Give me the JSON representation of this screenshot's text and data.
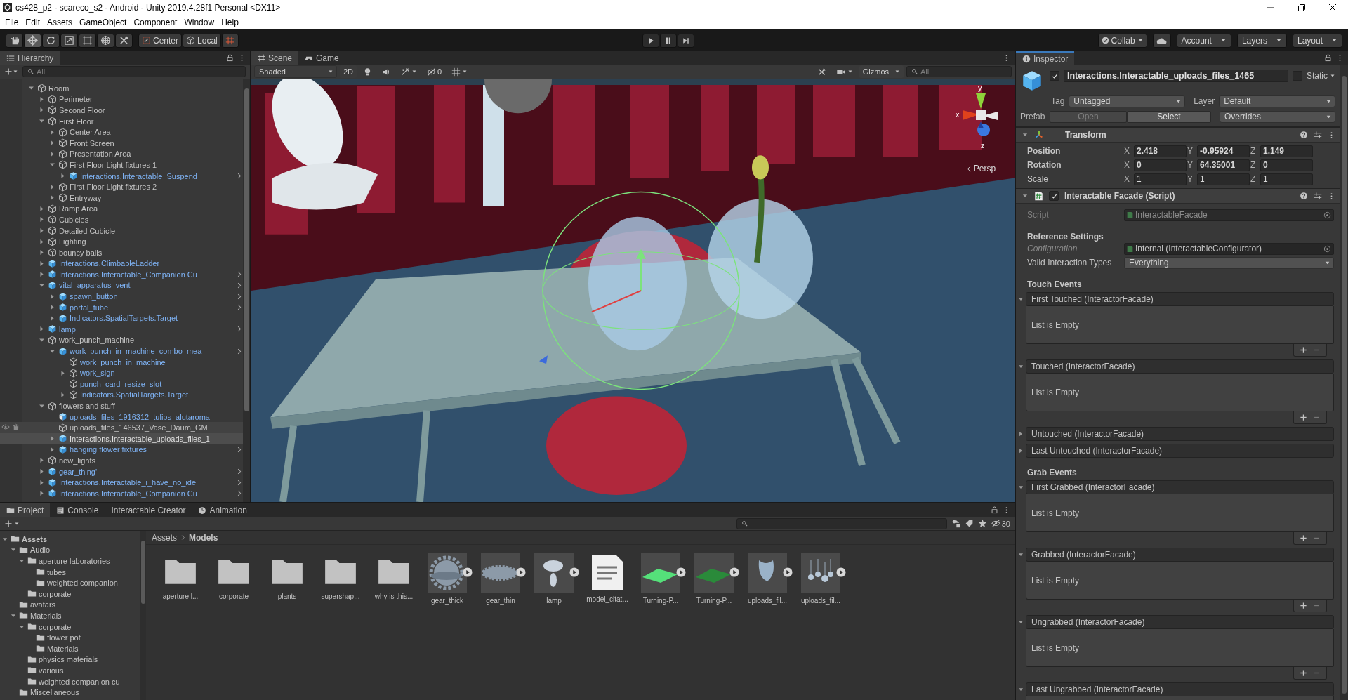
{
  "window": {
    "title": "cs428_p2 - scareco_s2 - Android - Unity 2019.4.28f1 Personal <DX11>"
  },
  "menu": [
    "File",
    "Edit",
    "Assets",
    "GameObject",
    "Component",
    "Window",
    "Help"
  ],
  "toolbar": {
    "tools": [
      {
        "kind": "hand",
        "selected": false
      },
      {
        "kind": "move",
        "selected": true
      },
      {
        "kind": "rotate",
        "selected": false
      },
      {
        "kind": "scale",
        "selected": false
      },
      {
        "kind": "rect",
        "selected": false
      },
      {
        "kind": "transform",
        "selected": false
      },
      {
        "kind": "custom",
        "selected": false
      }
    ],
    "pivot": "Center",
    "space": "Local",
    "play_controls": [
      {
        "kind": "play"
      },
      {
        "kind": "pause"
      },
      {
        "kind": "step"
      }
    ],
    "collab": "Collab",
    "account": "Account",
    "layers": "Layers",
    "layout": "Layout"
  },
  "hierarchy": {
    "title": "Hierarchy",
    "search_placeholder": "All",
    "items": [
      {
        "name": "Room",
        "kind": "gameobject",
        "expanded": true,
        "selected": false,
        "hovered": false,
        "children": [
          {
            "name": "Perimeter",
            "kind": "gameobject",
            "expanded": false,
            "selected": false,
            "hovered": false
          },
          {
            "name": "Second Floor",
            "kind": "gameobject",
            "expanded": false,
            "selected": false,
            "hovered": false
          },
          {
            "name": "First Floor",
            "kind": "gameobject",
            "expanded": true,
            "selected": false,
            "hovered": false,
            "children": [
              {
                "name": "Center Area",
                "kind": "gameobject",
                "expanded": false,
                "selected": false,
                "hovered": false
              },
              {
                "name": "Front Screen",
                "kind": "gameobject",
                "expanded": false,
                "selected": false,
                "hovered": false
              },
              {
                "name": "Presentation Area",
                "kind": "gameobject",
                "expanded": false,
                "selected": false,
                "hovered": false
              },
              {
                "name": "First Floor Light fixtures 1",
                "kind": "gameobject",
                "expanded": true,
                "selected": false,
                "hovered": false,
                "children": [
                  {
                    "name": "Interactions.Interactable_Suspend",
                    "kind": "prefab",
                    "expanded": false,
                    "selected": false,
                    "hovered": false,
                    "arrow": true
                  }
                ]
              },
              {
                "name": "First Floor Light fixtures 2",
                "kind": "gameobject",
                "expanded": false,
                "selected": false,
                "hovered": false
              },
              {
                "name": "Entryway",
                "kind": "gameobject",
                "expanded": false,
                "selected": false,
                "hovered": false
              }
            ]
          },
          {
            "name": "Ramp Area",
            "kind": "gameobject",
            "expanded": false,
            "selected": false,
            "hovered": false
          },
          {
            "name": "Cubicles",
            "kind": "gameobject",
            "expanded": false,
            "selected": false,
            "hovered": false
          },
          {
            "name": "Detailed Cubicle",
            "kind": "gameobject",
            "expanded": false,
            "selected": false,
            "hovered": false
          },
          {
            "name": "Lighting",
            "kind": "gameobject",
            "expanded": false,
            "selected": false,
            "hovered": false
          },
          {
            "name": "bouncy balls",
            "kind": "gameobject",
            "expanded": false,
            "selected": false,
            "hovered": false
          },
          {
            "name": "Interactions.ClimbableLadder",
            "kind": "prefab",
            "expanded": false,
            "selected": false,
            "hovered": false
          },
          {
            "name": "Interactions.Interactable_Companion Cu",
            "kind": "prefab",
            "expanded": false,
            "selected": false,
            "hovered": false,
            "arrow": true
          },
          {
            "name": "vital_apparatus_vent",
            "kind": "prefab",
            "expanded": true,
            "selected": false,
            "hovered": false,
            "arrow": true,
            "children": [
              {
                "name": "spawn_button",
                "kind": "prefab",
                "expanded": false,
                "selected": false,
                "hovered": false,
                "arrow": true
              },
              {
                "name": "portal_tube",
                "kind": "prefab",
                "expanded": false,
                "selected": false,
                "hovered": false,
                "arrow": true
              },
              {
                "name": "Indicators.SpatialTargets.Target",
                "kind": "prefab",
                "expanded": false,
                "selected": false,
                "hovered": false
              }
            ]
          },
          {
            "name": "lamp",
            "kind": "prefab",
            "expanded": false,
            "selected": false,
            "hovered": false,
            "arrow": true
          },
          {
            "name": "work_punch_machine",
            "kind": "gameobject",
            "expanded": true,
            "selected": false,
            "hovered": false,
            "children": [
              {
                "name": "work_punch_in_machine_combo_mea",
                "kind": "prefab",
                "expanded": true,
                "selected": false,
                "hovered": false,
                "arrow": true,
                "children": [
                  {
                    "name": "work_punch_in_machine",
                    "kind": "prefab_child",
                    "selected": false,
                    "hovered": false
                  },
                  {
                    "name": "work_sign",
                    "kind": "prefab_child",
                    "expanded": false,
                    "selected": false,
                    "hovered": false
                  },
                  {
                    "name": "punch_card_resize_slot",
                    "kind": "prefab_child",
                    "selected": false,
                    "hovered": false
                  },
                  {
                    "name": "Indicators.SpatialTargets.Target",
                    "kind": "prefab_child",
                    "expanded": false,
                    "selected": false,
                    "hovered": false
                  }
                ]
              }
            ]
          },
          {
            "name": "flowers and stuff",
            "kind": "gameobject",
            "expanded": true,
            "selected": false,
            "hovered": false,
            "children": [
              {
                "name": "uploads_files_1916312_tulips_alutaroma",
                "kind": "model",
                "selected": false,
                "hovered": false
              },
              {
                "name": "uploads_files_146537_Vase_Daum_GM",
                "kind": "gameobject",
                "selected": false,
                "hovered": true
              },
              {
                "name": "Interactions.Interactable_uploads_files_1",
                "kind": "prefab",
                "expanded": false,
                "selected": true,
                "hovered": false
              },
              {
                "name": "hanging flower fixtures",
                "kind": "prefab",
                "expanded": false,
                "selected": false,
                "hovered": false,
                "arrow": true
              }
            ]
          },
          {
            "name": "new_lights",
            "kind": "gameobject",
            "expanded": false,
            "selected": false,
            "hovered": false
          },
          {
            "name": "gear_thing'",
            "kind": "prefab",
            "expanded": false,
            "selected": false,
            "hovered": false,
            "arrow": true
          },
          {
            "name": "Interactions.Interactable_i_have_no_ide",
            "kind": "prefab",
            "expanded": false,
            "selected": false,
            "hovered": false,
            "arrow": true
          },
          {
            "name": "Interactions.Interactable_Companion Cu",
            "kind": "prefab",
            "expanded": false,
            "selected": false,
            "hovered": false,
            "arrow": true
          }
        ]
      }
    ]
  },
  "scene": {
    "tabs": [
      {
        "label": "Scene",
        "kind": "scene",
        "selected": true
      },
      {
        "label": "Game",
        "kind": "game",
        "selected": false
      }
    ],
    "shading": "Shaded",
    "mode_2d": {
      "label": "2D",
      "on": false
    },
    "hidden_count": "0",
    "gizmos": "Gizmos",
    "search_placeholder": "All",
    "gizmo": {
      "x": "x",
      "y": "y",
      "z": "z",
      "projection": "Persp"
    }
  },
  "inspector": {
    "title": "Inspector",
    "object": {
      "active": true,
      "name": "Interactions.Interactable_uploads_files_1465",
      "static": false,
      "static_label": "Static",
      "tag_label": "Tag",
      "tag": "Untagged",
      "layer_label": "Layer",
      "layer": "Default",
      "prefab_label": "Prefab",
      "prefab_buttons": [
        {
          "label": "Open",
          "disabled": true
        },
        {
          "label": "Select",
          "disabled": false
        }
      ],
      "overrides": "Overrides"
    },
    "transform": {
      "title": "Transform",
      "expanded": true,
      "rows": [
        {
          "label": "Position",
          "overridden": true,
          "values": [
            {
              "axis": "X",
              "value": "2.418"
            },
            {
              "axis": "Y",
              "value": "-0.95924"
            },
            {
              "axis": "Z",
              "value": "1.149"
            }
          ]
        },
        {
          "label": "Rotation",
          "overridden": true,
          "values": [
            {
              "axis": "X",
              "value": "0"
            },
            {
              "axis": "Y",
              "value": "64.35001"
            },
            {
              "axis": "Z",
              "value": "0"
            }
          ]
        },
        {
          "label": "Scale",
          "overridden": false,
          "values": [
            {
              "axis": "X",
              "value": "1"
            },
            {
              "axis": "Y",
              "value": "1"
            },
            {
              "axis": "Z",
              "value": "1"
            }
          ]
        }
      ]
    },
    "script": {
      "title": "Interactable Facade (Script)",
      "enabled": true,
      "expanded": true,
      "script_label": "Script",
      "script_value": "InteractableFacade",
      "section": "Reference Settings",
      "configuration_label": "Configuration",
      "configuration_value": "Internal (InteractableConfigurator)",
      "types_label": "Valid Interaction Types",
      "types_value": "Everything",
      "event_groups": [
        {
          "title": "Touch Events",
          "events": [
            {
              "label": "First Touched (InteractorFacade)",
              "expanded": true,
              "empty_text": "List is Empty"
            },
            {
              "label": "Touched (InteractorFacade)",
              "expanded": true,
              "empty_text": "List is Empty"
            },
            {
              "label": "Untouched (InteractorFacade)",
              "expanded": false
            },
            {
              "label": "Last Untouched (InteractorFacade)",
              "expanded": false
            }
          ]
        },
        {
          "title": "Grab Events",
          "events": [
            {
              "label": "First Grabbed (InteractorFacade)",
              "expanded": true,
              "empty_text": "List is Empty"
            },
            {
              "label": "Grabbed (InteractorFacade)",
              "expanded": true,
              "empty_text": "List is Empty"
            },
            {
              "label": "Ungrabbed (InteractorFacade)",
              "expanded": true,
              "empty_text": "List is Empty"
            },
            {
              "label": "Last Ungrabbed (InteractorFacade)",
              "expanded": true
            }
          ]
        }
      ]
    }
  },
  "project": {
    "tabs": [
      {
        "label": "Project",
        "kind": "project",
        "selected": true
      },
      {
        "label": "Console",
        "kind": "console",
        "selected": false
      },
      {
        "label": "Interactable Creator",
        "kind": "plain",
        "selected": false
      },
      {
        "label": "Animation",
        "kind": "animation",
        "selected": false
      }
    ],
    "hidden_count": "30",
    "tree": [
      {
        "name": "Assets",
        "expanded": true,
        "children": [
          {
            "name": "Audio",
            "expanded": true,
            "children": [
              {
                "name": "aperture laboratories",
                "expanded": true,
                "children": [
                  {
                    "name": "tubes"
                  },
                  {
                    "name": "weighted companion"
                  }
                ]
              },
              {
                "name": "corporate"
              }
            ]
          },
          {
            "name": "avatars"
          },
          {
            "name": "Materials",
            "expanded": true,
            "children": [
              {
                "name": "corporate",
                "expanded": true,
                "children": [
                  {
                    "name": "flower pot"
                  },
                  {
                    "name": "Materials"
                  }
                ]
              },
              {
                "name": "physics materials"
              },
              {
                "name": "various"
              },
              {
                "name": "weighted companion cu"
              }
            ]
          },
          {
            "name": "Miscellaneous"
          }
        ]
      }
    ],
    "breadcrumb": [
      "Assets",
      "Models"
    ],
    "assets": [
      {
        "label": "aperture l...",
        "kind": "folder"
      },
      {
        "label": "corporate",
        "kind": "folder"
      },
      {
        "label": "plants",
        "kind": "folder"
      },
      {
        "label": "supershap...",
        "kind": "folder"
      },
      {
        "label": "why is this...",
        "kind": "folder"
      },
      {
        "label": "gear_thick",
        "kind": "gear"
      },
      {
        "label": "gear_thin",
        "kind": "disc"
      },
      {
        "label": "lamp",
        "kind": "lamp"
      },
      {
        "label": "model_citat...",
        "kind": "document"
      },
      {
        "label": "Turning-P...",
        "kind": "plane",
        "color": "#55e07a"
      },
      {
        "label": "Turning-P...",
        "kind": "plane",
        "color": "#2a8a3a"
      },
      {
        "label": "uploads_fil...",
        "kind": "vase"
      },
      {
        "label": "uploads_fil...",
        "kind": "cluster"
      }
    ]
  }
}
